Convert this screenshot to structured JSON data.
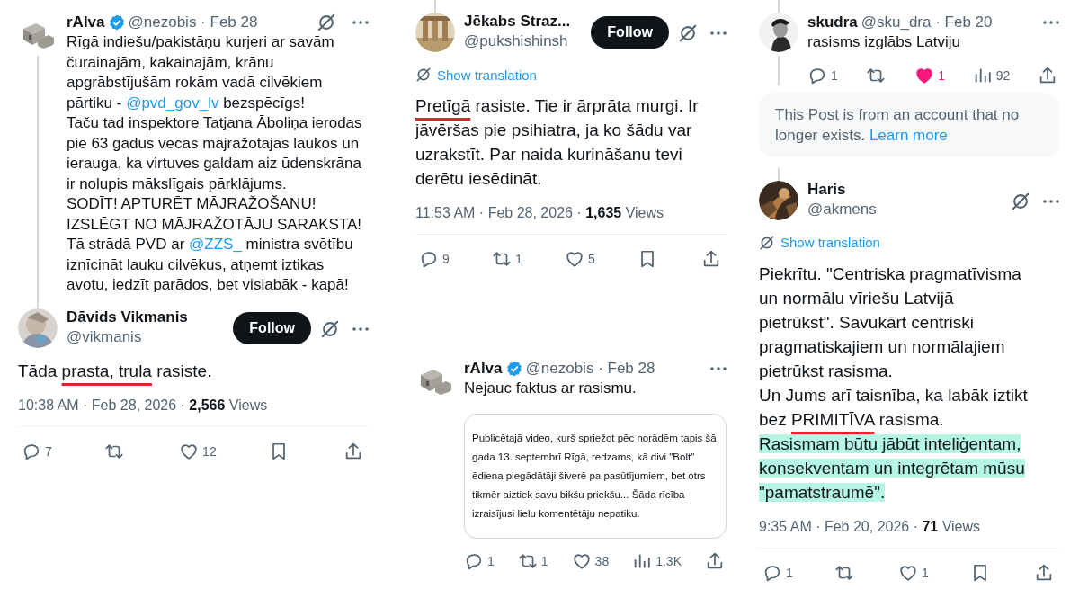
{
  "columns": [
    {
      "posts": [
        {
          "kind": "thread",
          "name": "rAlva",
          "verified": true,
          "byline": "@nezobis · Feb 28",
          "grok_icon": true,
          "line_below": true,
          "text": [
            {
              "kind": "plain",
              "text": "Rīgā indiešu/pakistāņu kurjeri ar savām čurainajām, kakainajām, krānu apgrābstījušām rokām vadā cilvēkiem pārtiku - "
            },
            {
              "kind": "mention",
              "text": "@pvd_gov_lv"
            },
            {
              "kind": "plain",
              "text": " bezspēcīgs!\nTaču tad inspektore Tatjana Āboliņa ierodas pie 63 gadus vecas mājražotājas laukos un ierauga, ka virtuves galdam aiz ūdenskrāna ir nolupis mākslīgais pārklājums.\nSODĪT! APTURĒT MĀJRAŽOŠANU! IZSLĒGT NO MĀJRAŽOTĀJU SARAKSTA!\nTā strādā PVD ar "
            },
            {
              "kind": "mention",
              "text": "@ZZS_"
            },
            {
              "kind": "plain",
              "text": " ministra svētību iznīcināt lauku cilvēkus, atņemt iztikas avotu, iedzīt parādos, bet vislabāk - kapā!"
            }
          ]
        },
        {
          "kind": "detail",
          "name": "Dāvids Vikmanis",
          "handle": "@vikmanis",
          "follow": "Follow",
          "grok_icon": true,
          "line_above": true,
          "text": [
            {
              "kind": "plain",
              "text": "Tāda "
            },
            {
              "kind": "underline",
              "text": "prasta, trula"
            },
            {
              "kind": "plain",
              "text": " rasiste."
            }
          ],
          "meta": "10:38 AM · Feb 28, 2026 · **2,566** Views",
          "actions": [
            {
              "kind": "reply",
              "count": "7"
            },
            {
              "kind": "repost",
              "on": false
            },
            {
              "kind": "like",
              "count": "12",
              "on": false
            },
            {
              "kind": "bookmark",
              "on": false
            },
            {
              "kind": "share"
            }
          ]
        }
      ]
    },
    {
      "posts": [
        {
          "kind": "detail",
          "name": "Jēkabs Straz...",
          "handle": "@pukshishinsh",
          "follow": "Follow",
          "grok_icon": true,
          "line_above": true,
          "translation": "Show translation",
          "text": [
            {
              "kind": "underline",
              "text": "Pretīgā"
            },
            {
              "kind": "plain",
              "text": " rasiste. Tie ir ārprāta murgi. Ir jāvēršas pie psihiatra, ja ko šādu var uzrakstīt. Par naida kurināšanu tevi derētu iesēdināt."
            }
          ],
          "meta": "11:53 AM · Feb 28, 2026 · **1,635** Views",
          "actions": [
            {
              "kind": "reply",
              "count": "9"
            },
            {
              "kind": "repost",
              "count": "1",
              "on": false
            },
            {
              "kind": "like",
              "count": "5",
              "on": false
            },
            {
              "kind": "bookmark",
              "on": false
            },
            {
              "kind": "share"
            }
          ]
        },
        {
          "kind": "thread",
          "name": "rAlva",
          "verified": true,
          "byline": "@nezobis · Feb 28",
          "text": [
            {
              "kind": "plain",
              "text": "Nejauc faktus ar rasismu."
            }
          ],
          "quote": "Publicētajā video, kurš spriežot pēc norādēm tapis šā gada 13. septembrī Rīgā, redzams, kā divi \"Bolt\" ēdiena piegādātāji šiverē pa pasūtījumiem, bet otrs tikmēr aiztiek savu bikšu priekšu... Šāda rīcība izraisījusi lielu komentētāju nepatiku.",
          "actions": [
            {
              "kind": "reply",
              "count": "1"
            },
            {
              "kind": "repost",
              "count": "1",
              "on": false
            },
            {
              "kind": "like",
              "count": "38",
              "on": false
            },
            {
              "kind": "views",
              "count": "1.3K"
            },
            {
              "kind": "share"
            }
          ]
        }
      ]
    },
    {
      "posts": [
        {
          "kind": "thread",
          "name": "skudra",
          "byline": "@sku_dra · Feb 20",
          "line_above": true,
          "line_below": true,
          "text": [
            {
              "kind": "plain",
              "text": "rasisms izglābs Latviju"
            }
          ],
          "actions": [
            {
              "kind": "reply",
              "count": "1"
            },
            {
              "kind": "repost",
              "on": false
            },
            {
              "kind": "like",
              "count": "1",
              "on": true
            },
            {
              "kind": "views",
              "count": "92"
            },
            {
              "kind": "share"
            }
          ]
        },
        {
          "kind": "notice",
          "text": [
            {
              "kind": "plain",
              "text": "This Post is from an account that no longer exists. "
            },
            {
              "kind": "link",
              "text": "Learn more"
            }
          ]
        },
        {
          "kind": "detail",
          "name": "Haris",
          "handle": "@akmens",
          "grok_icon": true,
          "line_above": true,
          "translation": "Show translation",
          "text": [
            {
              "kind": "plain",
              "text": "Piekrītu. \"Centriska pragmatīvisma un normālu vīriešu Latvijā pietrūkst\".  Savukārt centriski pragmatiskajiem un normālajiem pietrūkst rasisma.\nUn Jums arī taisnība, ka labāk iztikt bez "
            },
            {
              "kind": "underline",
              "text": "PRIMITĪVA"
            },
            {
              "kind": "plain",
              "text": " rasisma.\n"
            },
            {
              "kind": "highlight",
              "text": "Rasismam būtu jābūt inteliģentam, konsekventam un integrētam mūsu \"pamatstraumē\"."
            }
          ],
          "meta": "9:35 AM · Feb 20, 2026 · **71** Views",
          "actions": [
            {
              "kind": "reply",
              "count": "1"
            },
            {
              "kind": "repost",
              "on": false
            },
            {
              "kind": "like",
              "count": "1",
              "on": false
            },
            {
              "kind": "bookmark",
              "on": false
            },
            {
              "kind": "share"
            }
          ]
        }
      ]
    }
  ]
}
